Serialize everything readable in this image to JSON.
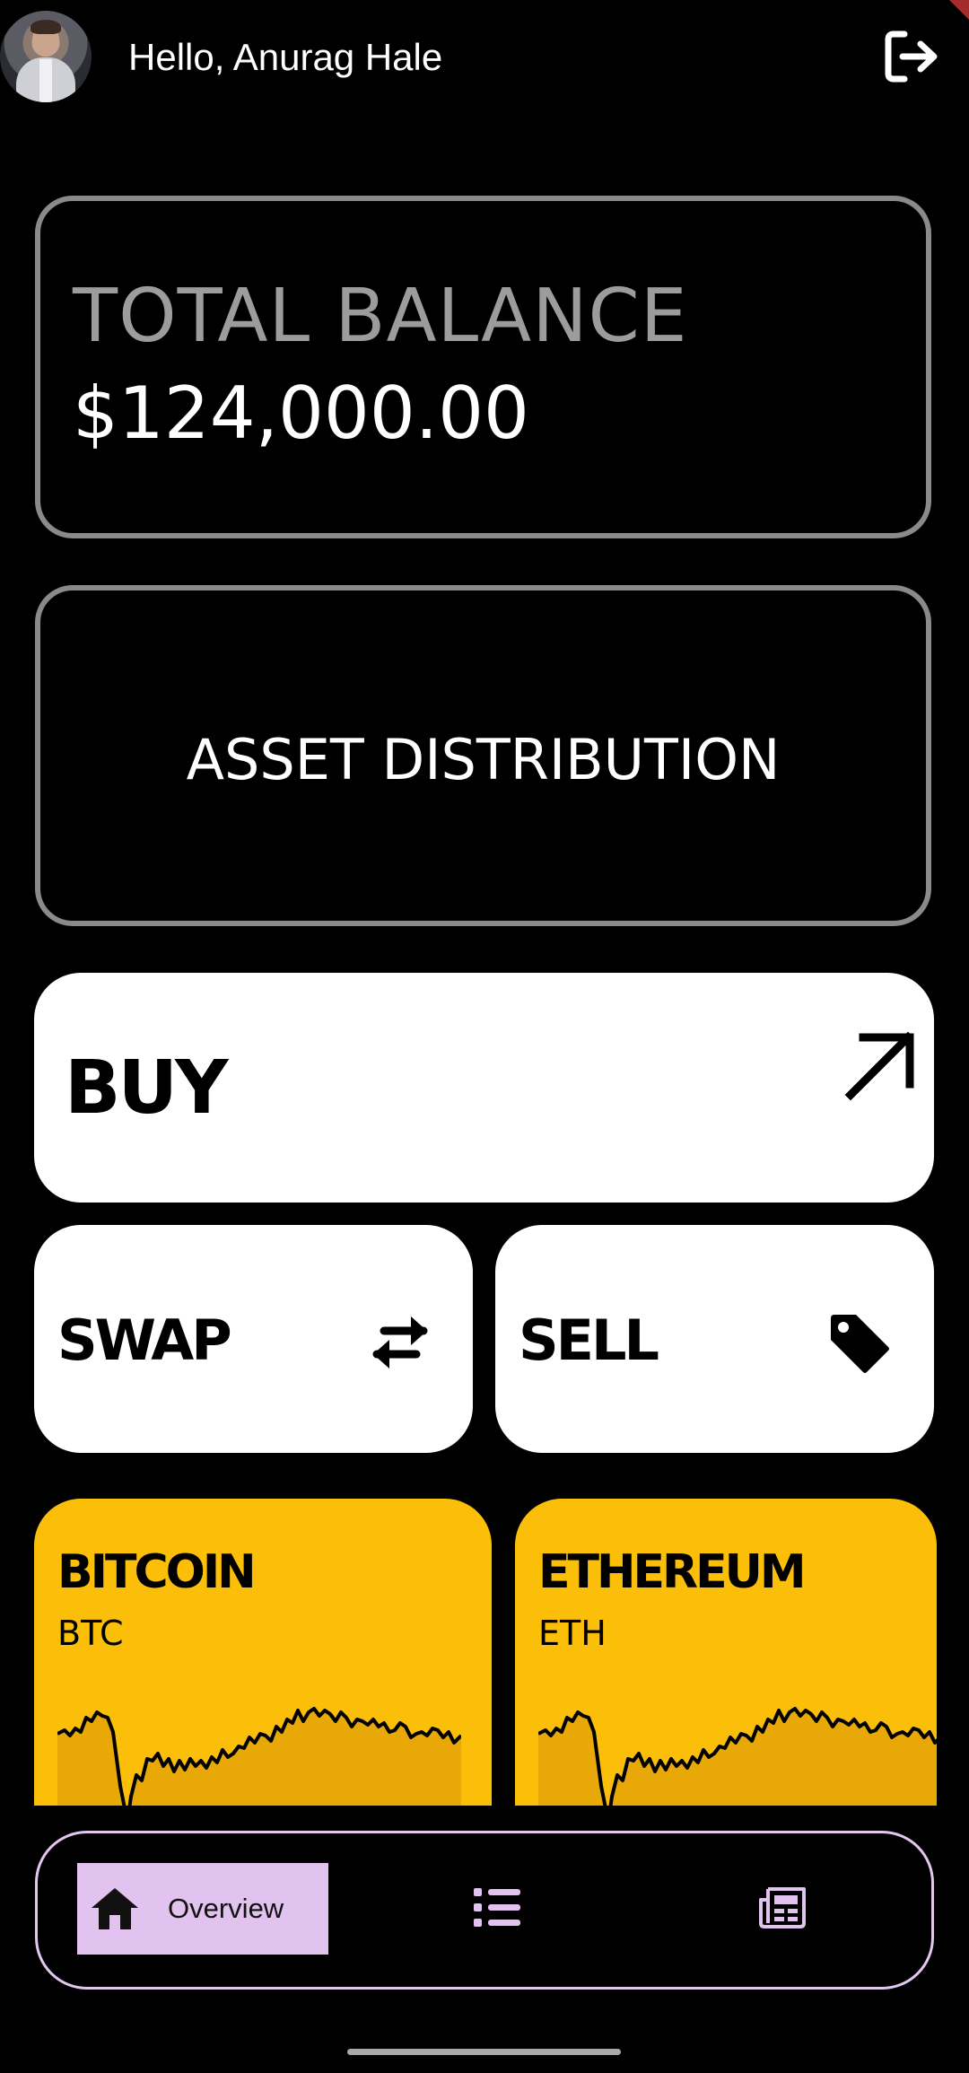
{
  "header": {
    "greeting": "Hello, Anurag Hale",
    "avatar_icon": "user-avatar",
    "logout_icon": "logout-icon"
  },
  "balance": {
    "title": "TOTAL BALANCE",
    "value": "$124,000.00"
  },
  "distribution": {
    "title": "ASSET DISTRIBUTION"
  },
  "actions": {
    "buy": {
      "label": "BUY",
      "icon": "arrow-up-right-icon"
    },
    "swap": {
      "label": "SWAP",
      "icon": "swap-arrows-icon"
    },
    "sell": {
      "label": "SELL",
      "icon": "tag-icon"
    }
  },
  "coins": [
    {
      "name": "BITCOIN",
      "symbol": "BTC"
    },
    {
      "name": "ETHEREUM",
      "symbol": "ETH"
    }
  ],
  "nav": {
    "overview_label": "Overview",
    "items": [
      "home-icon",
      "list-icon",
      "newspaper-icon"
    ]
  },
  "colors": {
    "background": "#000000",
    "card_border": "#8a8a8a",
    "coin_card": "#fbbf0a",
    "nav_active": "#e2c2ef",
    "nav_border": "#e2c7ee"
  }
}
